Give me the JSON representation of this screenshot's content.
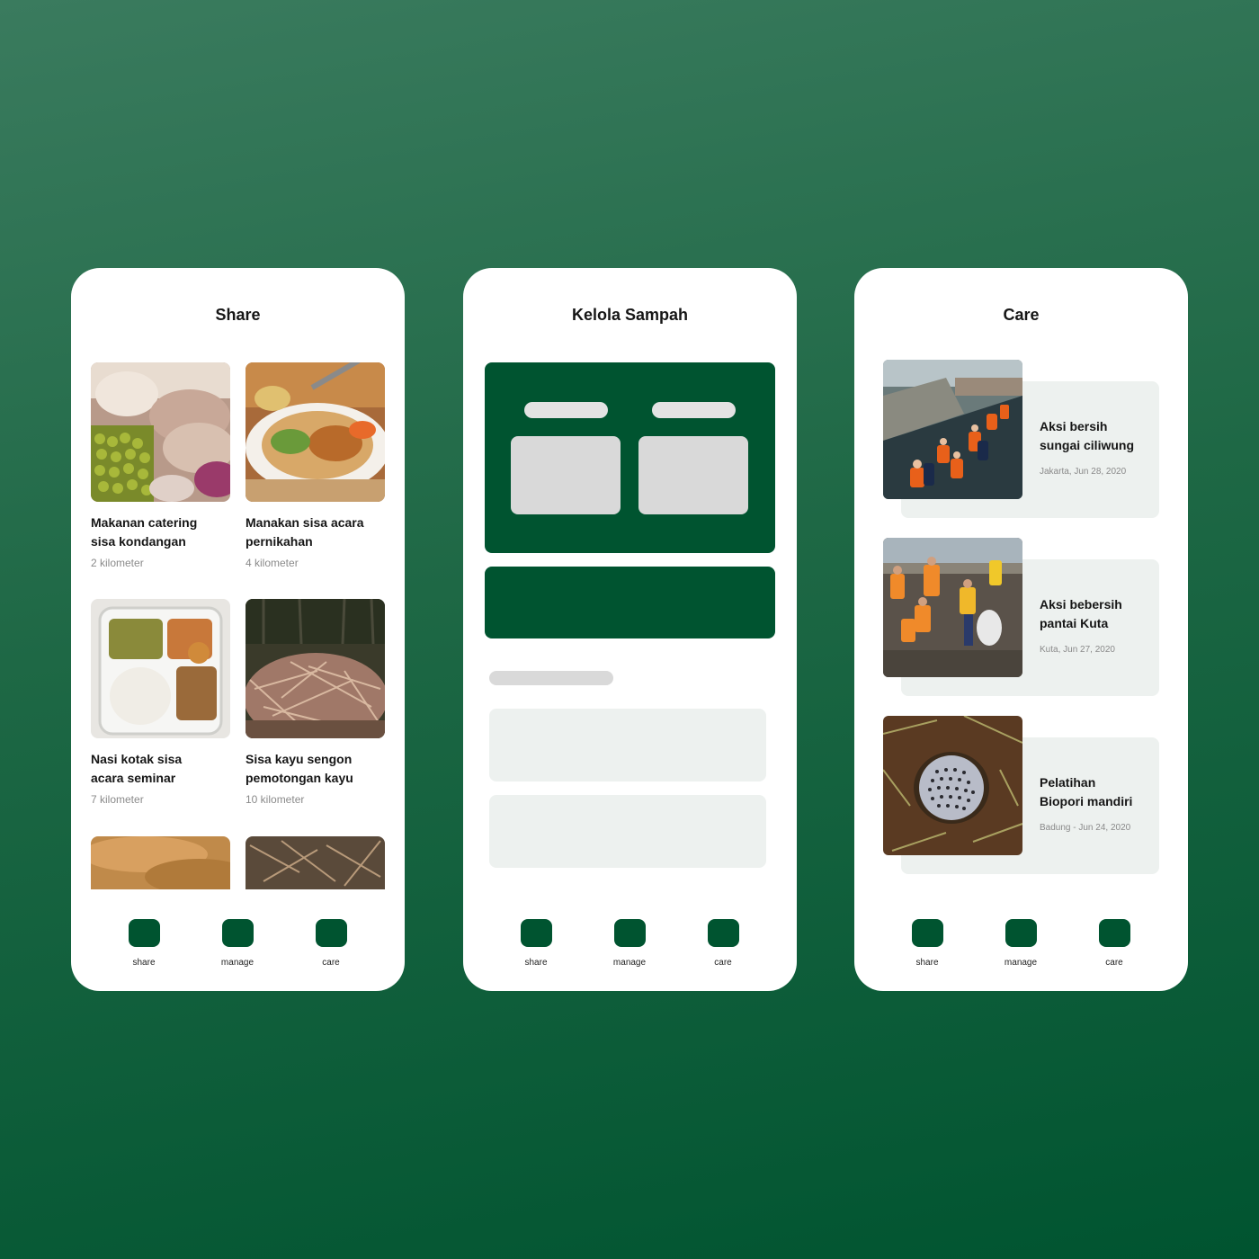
{
  "colors": {
    "brand": "#005430",
    "skeleton": "#d9d9d9",
    "card_bg": "#edf1ef"
  },
  "share": {
    "title": "Share",
    "items": [
      {
        "name_line1": "Makanan catering",
        "name_line2": "sisa kondangan",
        "distance": "2 kilometer"
      },
      {
        "name_line1": "Manakan sisa acara",
        "name_line2": "pernikahan",
        "distance": "4 kilometer"
      },
      {
        "name_line1": "Nasi kotak sisa",
        "name_line2": "acara seminar",
        "distance": "7 kilometer"
      },
      {
        "name_line1": "Sisa kayu sengon",
        "name_line2": "pemotongan kayu",
        "distance": "10 kilometer"
      }
    ]
  },
  "manage": {
    "title": "Kelola Sampah"
  },
  "care": {
    "title": "Care",
    "items": [
      {
        "title_line1": "Aksi bersih",
        "title_line2": "sungai ciliwung",
        "meta": "Jakarta, Jun 28, 2020"
      },
      {
        "title_line1": "Aksi bebersih",
        "title_line2": "pantai Kuta",
        "meta": "Kuta, Jun 27, 2020"
      },
      {
        "title_line1": "Pelatihan",
        "title_line2": "Biopori mandiri",
        "meta": "Badung - Jun 24, 2020"
      }
    ]
  },
  "nav": {
    "share": "share",
    "manage": "manage",
    "care": "care"
  }
}
